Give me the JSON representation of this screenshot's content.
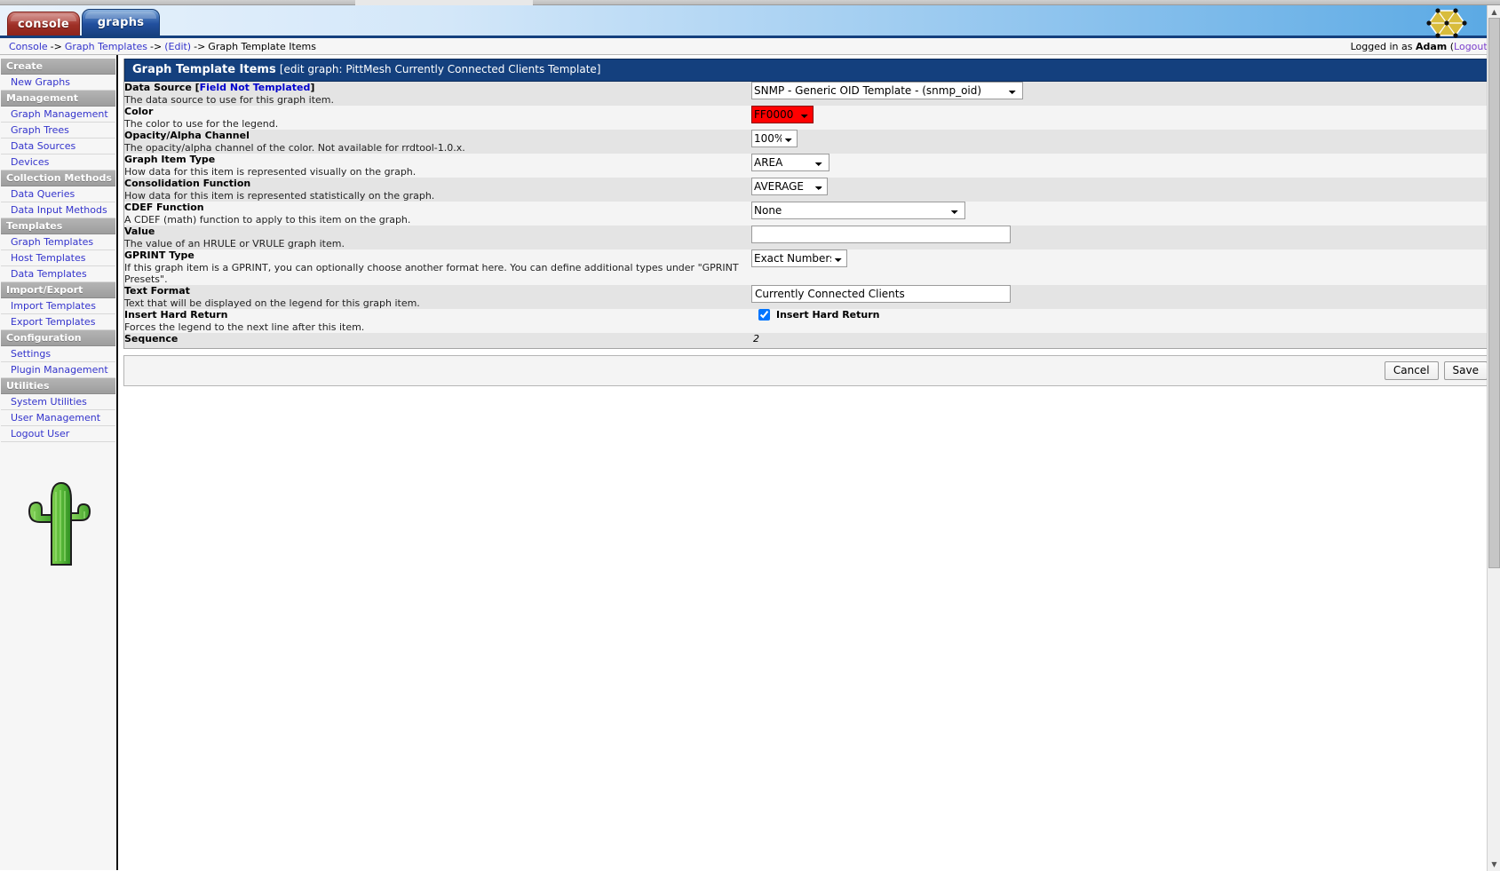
{
  "header": {
    "tabs": [
      {
        "label": "console",
        "name": "tab-console"
      },
      {
        "label": "graphs",
        "name": "tab-graphs"
      }
    ],
    "logo_icon": "cacti-hexagon-logo-icon"
  },
  "breadcrumb": {
    "items": [
      "Console",
      "Graph Templates",
      "(Edit)",
      "Graph Template Items"
    ],
    "sep": "->",
    "logged_in_prefix": "Logged in as",
    "user": "Adam",
    "logout_open": "(",
    "logout_label": "Logout",
    "logout_close": ")"
  },
  "sidebar": {
    "groups": [
      {
        "title": "Create",
        "items": [
          {
            "label": "New Graphs"
          }
        ]
      },
      {
        "title": "Management",
        "items": [
          {
            "label": "Graph Management"
          },
          {
            "label": "Graph Trees"
          },
          {
            "label": "Data Sources"
          },
          {
            "label": "Devices"
          }
        ]
      },
      {
        "title": "Collection Methods",
        "items": [
          {
            "label": "Data Queries"
          },
          {
            "label": "Data Input Methods"
          }
        ]
      },
      {
        "title": "Templates",
        "items": [
          {
            "label": "Graph Templates"
          },
          {
            "label": "Host Templates"
          },
          {
            "label": "Data Templates"
          }
        ]
      },
      {
        "title": "Import/Export",
        "items": [
          {
            "label": "Import Templates"
          },
          {
            "label": "Export Templates"
          }
        ]
      },
      {
        "title": "Configuration",
        "items": [
          {
            "label": "Settings"
          },
          {
            "label": "Plugin Management"
          }
        ]
      },
      {
        "title": "Utilities",
        "items": [
          {
            "label": "System Utilities"
          },
          {
            "label": "User Management"
          },
          {
            "label": "Logout User"
          }
        ]
      }
    ],
    "cactus_icon": "cactus-logo-icon"
  },
  "panel": {
    "title_main": "Graph Template Items",
    "title_sub": "[edit graph: PittMesh Currently Connected Clients Template]",
    "fields": {
      "data_source": {
        "label": "Data Source [",
        "label_link": "Field Not Templated",
        "label_tail": "]",
        "desc": "The data source to use for this graph item.",
        "value": "SNMP - Generic OID Template - (snmp_oid)"
      },
      "color": {
        "label": "Color",
        "desc": "The color to use for the legend.",
        "value": "FF0000",
        "swatch_hex": "#FF0000"
      },
      "opacity": {
        "label": "Opacity/Alpha Channel",
        "desc": "The opacity/alpha channel of the color. Not available for rrdtool-1.0.x.",
        "value": "100%"
      },
      "graph_item_type": {
        "label": "Graph Item Type",
        "desc": "How data for this item is represented visually on the graph.",
        "value": "AREA"
      },
      "consolidation_function": {
        "label": "Consolidation Function",
        "desc": "How data for this item is represented statistically on the graph.",
        "value": "AVERAGE"
      },
      "cdef_function": {
        "label": "CDEF Function",
        "desc": "A CDEF (math) function to apply to this item on the graph.",
        "value": "None"
      },
      "value": {
        "label": "Value",
        "desc": "The value of an HRULE or VRULE graph item.",
        "value": "",
        "placeholder": ""
      },
      "gprint_type": {
        "label": "GPRINT Type",
        "desc": "If this graph item is a GPRINT, you can optionally choose another format here. You can define additional types under \"GPRINT Presets\".",
        "value": "Exact Numbers"
      },
      "text_format": {
        "label": "Text Format",
        "desc": "Text that will be displayed on the legend for this graph item.",
        "value": "Currently Connected Clients",
        "placeholder": ""
      },
      "insert_hard_return": {
        "label": "Insert Hard Return",
        "desc": "Forces the legend to the next line after this item.",
        "checkbox_label": "Insert Hard Return",
        "checked": true
      },
      "sequence": {
        "label": "Sequence",
        "value": "2"
      }
    },
    "actions": {
      "cancel_label": "Cancel",
      "save_label": "Save"
    }
  },
  "colors": {
    "panel_header": "#14407e",
    "accent_red": "#FF0000",
    "link": "#3333cc"
  }
}
